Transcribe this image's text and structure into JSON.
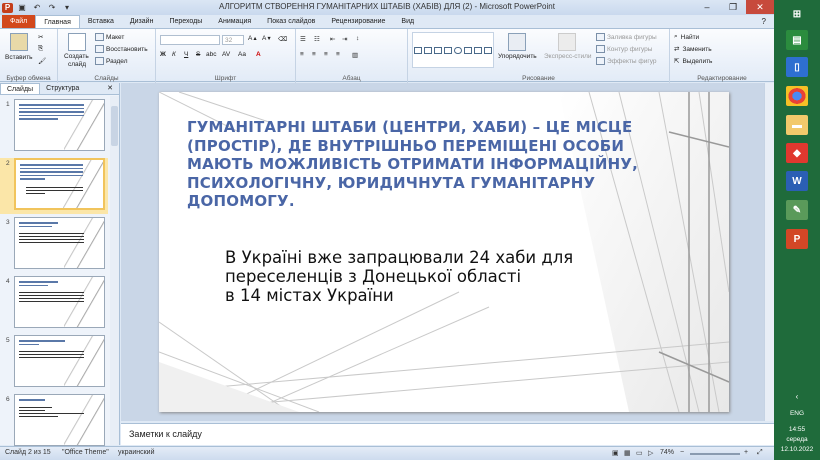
{
  "window": {
    "title": "АЛГОРИТМ СТВОРЕННЯ ГУМАНІТАРНИХ ШТАБІВ (ХАБІВ) ДЛЯ (2)  -  Microsoft PowerPoint",
    "minimize": "–",
    "maximize": "❐",
    "close": "✕",
    "help": "?"
  },
  "quick_access": {
    "logo": "P",
    "save": "▣",
    "undo": "↶",
    "redo": "↷",
    "more": "▾"
  },
  "menu": {
    "file": "Файл",
    "tabs": [
      "Главная",
      "Вставка",
      "Дизайн",
      "Переходы",
      "Анимация",
      "Показ слайдов",
      "Рецензирование",
      "Вид"
    ]
  },
  "ribbon": {
    "clipboard": {
      "paste": "Вставить",
      "label": "Буфер обмена"
    },
    "slides": {
      "create": "Создать",
      "create2": "слайд",
      "layout": "Макет",
      "reset": "Восстановить",
      "section": "Раздел",
      "label": "Слайды"
    },
    "font": {
      "size": "32",
      "bold": "Ж",
      "italic": "К",
      "underline": "Ч",
      "strike": "S",
      "shadow": "abc",
      "spacing": "AV",
      "case": "Aa",
      "label": "Шрифт"
    },
    "paragraph": {
      "label": "Абзац"
    },
    "drawing": {
      "arrange": "Упорядочить",
      "styles": "Экспресс-стили",
      "fill": "Заливка фигуры",
      "outline": "Контур фигуры",
      "effects": "Эффекты фигур",
      "label": "Рисование"
    },
    "editing": {
      "find": "Найти",
      "replace": "Заменить",
      "select": "Выделить",
      "label": "Редактирование"
    }
  },
  "left_pane": {
    "tabs": [
      "Слайды",
      "Структура"
    ],
    "close": "✕",
    "slides": [
      {
        "num": "1"
      },
      {
        "num": "2"
      },
      {
        "num": "3"
      },
      {
        "num": "4"
      },
      {
        "num": "5"
      },
      {
        "num": "6"
      }
    ]
  },
  "slide": {
    "heading": "ГУМАНІТАРНІ ШТАБИ (ЦЕНТРИ, ХАБИ) – ЦЕ МІСЦЕ (ПРОСТІР), ДЕ ВНУТРІШНЬО ПЕРЕМІЩЕНІ ОСОБИ МАЮТЬ МОЖЛИВІСТЬ ОТРИМАТИ ІНФОРМАЦІЙНУ, ПСИХОЛОГІЧНУ, ЮРИДИЧНУТА ГУМАНІТАРНУ ДОПОМОГУ.",
    "body_lines": [
      "В Україні вже запрацювали 24 хаби для",
      "переселенців з Донецької області",
      "в 14 містах України"
    ]
  },
  "notes": {
    "placeholder": "Заметки к слайду"
  },
  "status": {
    "slide": "Слайд 2 из 15",
    "theme": "\"Office Theme\"",
    "lang": "украинский",
    "zoom": "74%"
  },
  "taskbar": {
    "lang": "ENG",
    "time": "14:55",
    "day": "середа",
    "date": "12.10.2022"
  }
}
